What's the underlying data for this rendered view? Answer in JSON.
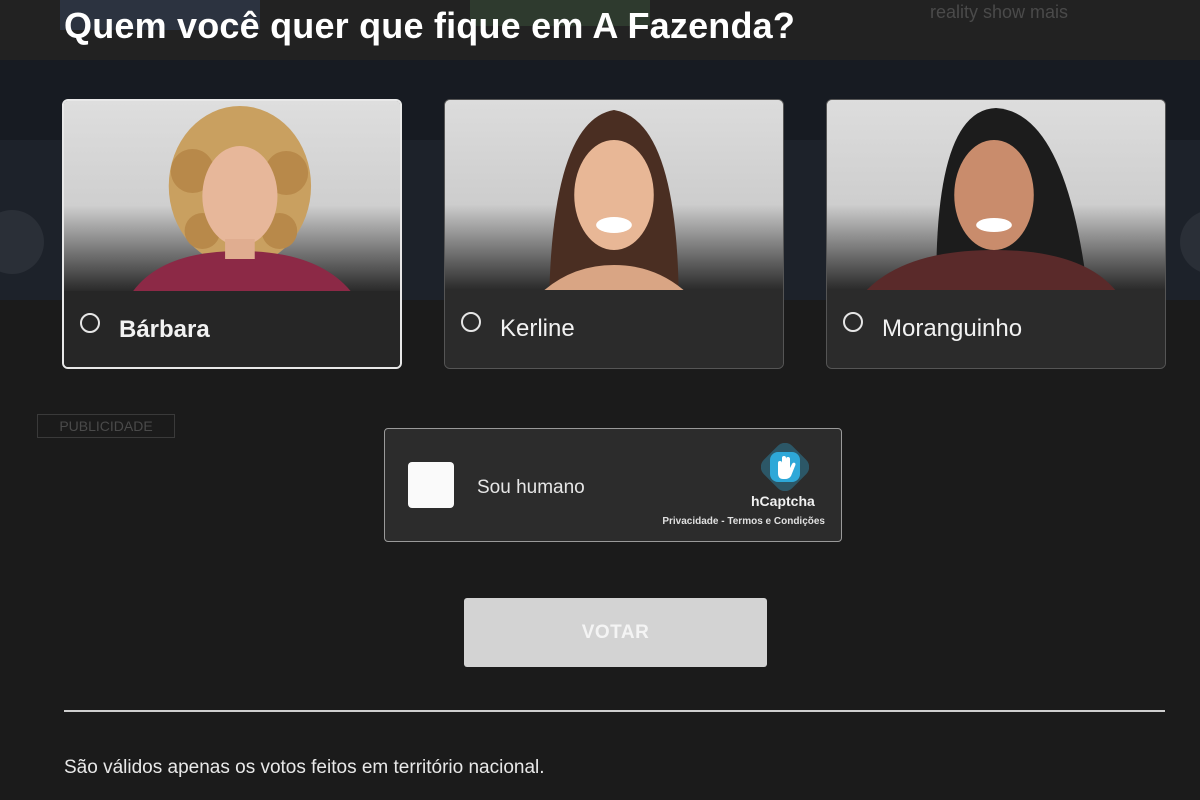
{
  "background": {
    "top_text": "reality show mais",
    "ad_label": "PUBLICIDADE"
  },
  "poll": {
    "title": "Quem você quer que fique em A Fazenda?",
    "options": [
      {
        "name": "Bárbara",
        "selected": true
      },
      {
        "name": "Kerline",
        "selected": false
      },
      {
        "name": "Moranguinho",
        "selected": false
      }
    ]
  },
  "captcha": {
    "label": "Sou humano",
    "brand": "hCaptcha",
    "privacy": "Privacidade",
    "separator": " - ",
    "terms": "Termos e Condições"
  },
  "vote_button": {
    "label": "VOTAR"
  },
  "footer": {
    "note": "São válidos apenas os votos feitos em território nacional."
  },
  "colors": {
    "accent_logo": "#2ea8d8",
    "button_bg": "#d3d3d3",
    "page_bg": "#1b1b1b"
  }
}
